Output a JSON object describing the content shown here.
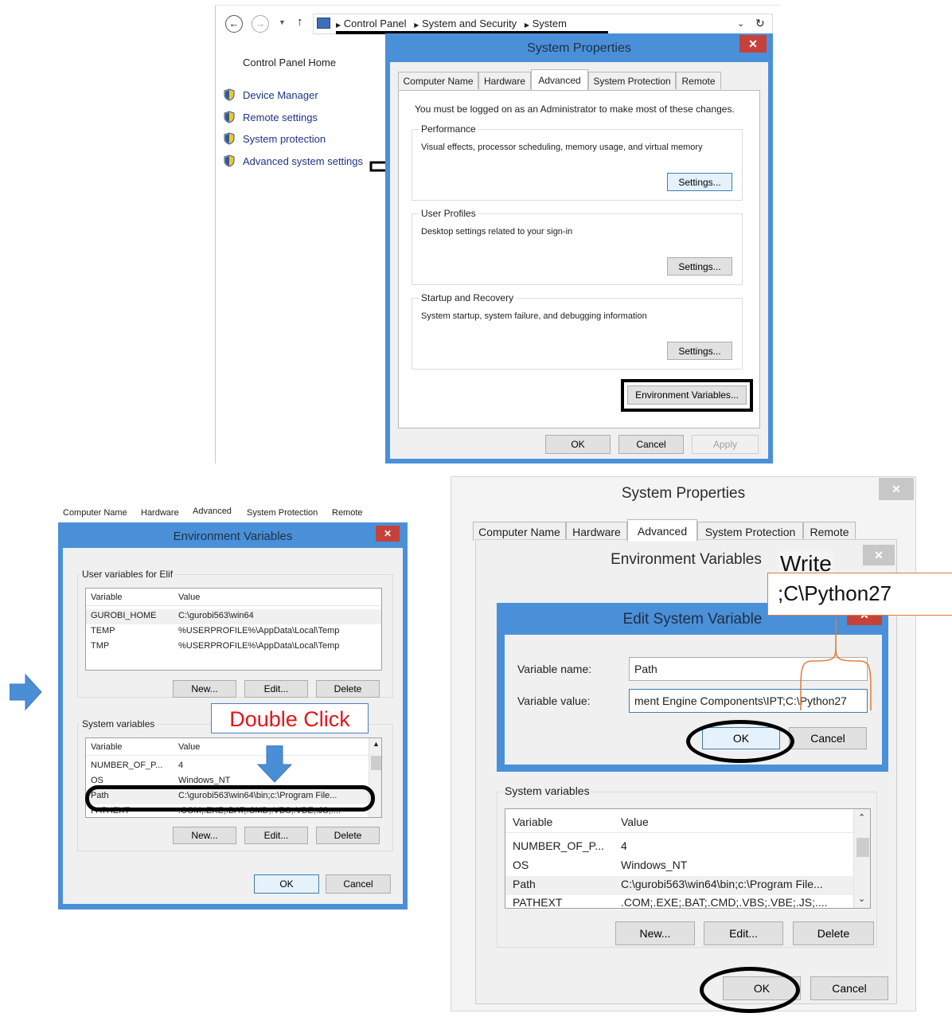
{
  "explorer": {
    "breadcrumb": [
      "Control Panel",
      "System and Security",
      "System"
    ],
    "sidebar_home": "Control Panel Home",
    "sidebar_links": [
      "Device Manager",
      "Remote settings",
      "System protection",
      "Advanced system settings"
    ]
  },
  "sysprops_top": {
    "title": "System Properties",
    "close": "✕",
    "tabs": [
      "Computer Name",
      "Hardware",
      "Advanced",
      "System Protection",
      "Remote"
    ],
    "admin_note": "You must be logged on as an Administrator to make most of these changes.",
    "performance": {
      "legend": "Performance",
      "desc": "Visual effects, processor scheduling, memory usage, and virtual memory",
      "button": "Settings..."
    },
    "profiles": {
      "legend": "User Profiles",
      "desc": "Desktop settings related to your sign-in",
      "button": "Settings..."
    },
    "startup": {
      "legend": "Startup and Recovery",
      "desc": "System startup, system failure, and debugging information",
      "button": "Settings..."
    },
    "env_button": "Environment Variables...",
    "ok": "OK",
    "cancel": "Cancel",
    "apply": "Apply"
  },
  "envvars_left": {
    "tabs_behind": [
      "Computer Name",
      "Hardware",
      "Advanced",
      "System Protection",
      "Remote"
    ],
    "title": "Environment Variables",
    "close": "✕",
    "user_legend": "User variables for Elif",
    "col_variable": "Variable",
    "col_value": "Value",
    "user_vars": [
      {
        "name": "GUROBI_HOME",
        "value": "C:\\gurobi563\\win64"
      },
      {
        "name": "TEMP",
        "value": "%USERPROFILE%\\AppData\\Local\\Temp"
      },
      {
        "name": "TMP",
        "value": "%USERPROFILE%\\AppData\\Local\\Temp"
      }
    ],
    "user_buttons": [
      "New...",
      "Edit...",
      "Delete"
    ],
    "system_legend": "System variables",
    "system_vars": [
      {
        "name": "NUMBER_OF_P...",
        "value": "4"
      },
      {
        "name": "OS",
        "value": "Windows_NT"
      },
      {
        "name": "Path",
        "value": "C:\\gurobi563\\win64\\bin;c:\\Program File..."
      },
      {
        "name": "PATHEXT",
        "value": ".COM;.EXE;.BAT;.CMD;.VBS;.VBE;.JS;...."
      }
    ],
    "system_buttons": [
      "New...",
      "Edit...",
      "Delete"
    ],
    "ok": "OK",
    "cancel": "Cancel",
    "annotation": "Double Click"
  },
  "right_panel": {
    "sysprops_title": "System Properties",
    "close": "✕",
    "tabs": [
      "Computer Name",
      "Hardware",
      "Advanced",
      "System Protection",
      "Remote"
    ],
    "env_title": "Environment Variables",
    "write_note_1": "Write",
    "write_note_2": ";C\\Python27",
    "edit_title": "Edit System Variable",
    "var_name_label": "Variable name:",
    "var_name_value": "Path",
    "var_value_label": "Variable value:",
    "var_value_value": "ment Engine Components\\IPT;C:\\Python27",
    "edit_ok": "OK",
    "edit_cancel": "Cancel",
    "system_legend": "System variables",
    "col_variable": "Variable",
    "col_value": "Value",
    "system_vars": [
      {
        "name": "NUMBER_OF_P...",
        "value": "4"
      },
      {
        "name": "OS",
        "value": "Windows_NT"
      },
      {
        "name": "Path",
        "value": "C:\\gurobi563\\win64\\bin;c:\\Program File..."
      },
      {
        "name": "PATHEXT",
        "value": ".COM;.EXE;.BAT;.CMD;.VBS;.VBE;.JS;...."
      }
    ],
    "system_buttons": [
      "New...",
      "Edit...",
      "Delete"
    ],
    "ok": "OK",
    "cancel": "Cancel"
  },
  "colors": {
    "window_frame": "#4a90d9",
    "close_red": "#c7413b",
    "annotation_red": "#e8141a",
    "annotation_orange": "#e07b39",
    "arrow_blue": "#4a8fd6"
  }
}
